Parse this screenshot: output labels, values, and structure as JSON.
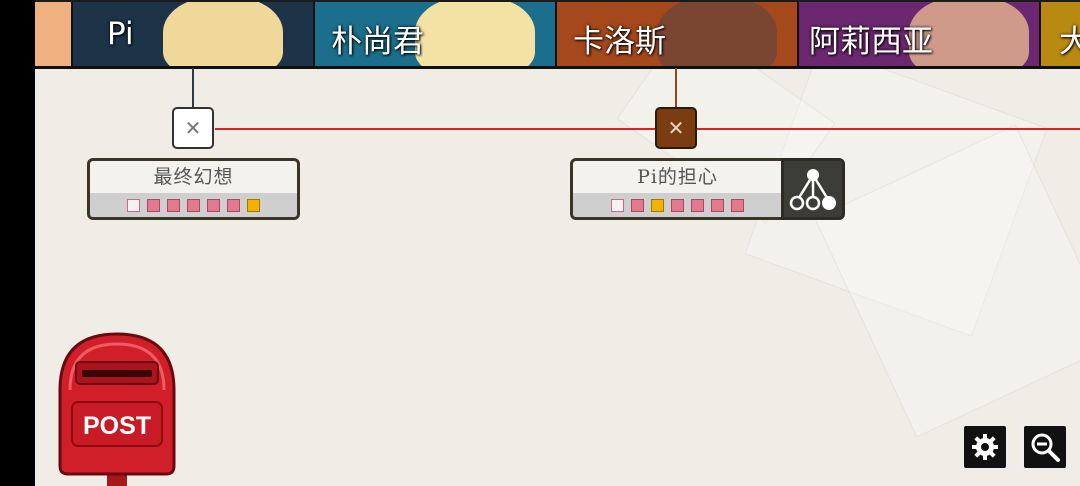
{
  "characters": [
    {
      "name": "",
      "color": "#d25a30"
    },
    {
      "name": "Pi",
      "color": "#1d3348"
    },
    {
      "name": "朴尚君",
      "color": "#1c6f8c"
    },
    {
      "name": "卡洛斯",
      "color": "#a5481b"
    },
    {
      "name": "阿莉西亚",
      "color": "#6b2870"
    },
    {
      "name": "大",
      "color": "#b88a12"
    }
  ],
  "nodes": [
    {
      "title": "最终幻想",
      "node_icon": "close-icon",
      "progress": [
        "empty",
        "pink",
        "pink",
        "pink",
        "pink",
        "pink",
        "gold"
      ]
    },
    {
      "title": "Pi的担心",
      "node_icon": "close-icon",
      "progress": [
        "empty",
        "pink",
        "gold",
        "pink",
        "pink",
        "pink",
        "pink"
      ]
    }
  ],
  "post": {
    "label": "POST"
  },
  "controls": {
    "settings_icon": "gear-icon",
    "zoom_icon": "zoom-out-icon"
  },
  "colors": {
    "route_line": "#e02020",
    "card_border": "#3d3428",
    "node2_fill": "#7a3d12"
  }
}
